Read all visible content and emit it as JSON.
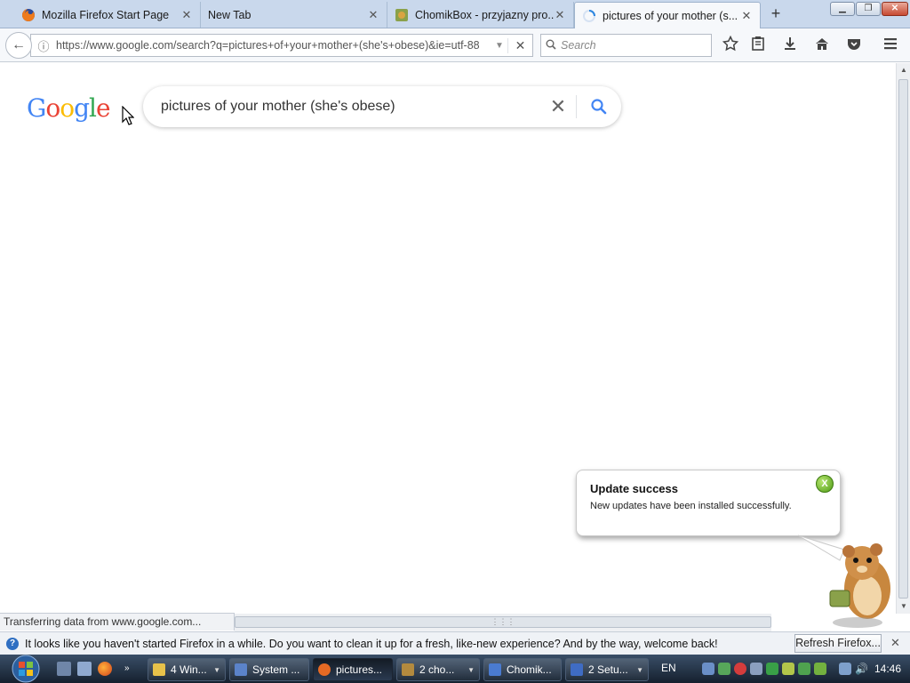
{
  "browser": {
    "tabs": [
      {
        "title": "Mozilla Firefox Start Page",
        "active": false
      },
      {
        "title": "New Tab",
        "active": false
      },
      {
        "title": "ChomikBox - przyjazny pro...",
        "active": false
      },
      {
        "title": "pictures of your mother (s...",
        "active": true
      }
    ],
    "url": "https://www.google.com/search?q=pictures+of+your+mother+(she's+obese)&ie=utf-88",
    "search_placeholder": "Search",
    "status_text": "Transferring data from www.google.com..."
  },
  "google": {
    "logo_letters": [
      {
        "ch": "G",
        "color": "#4285f4"
      },
      {
        "ch": "o",
        "color": "#ea4335"
      },
      {
        "ch": "o",
        "color": "#fbbc05"
      },
      {
        "ch": "g",
        "color": "#4285f4"
      },
      {
        "ch": "l",
        "color": "#34a853"
      },
      {
        "ch": "e",
        "color": "#ea4335"
      }
    ],
    "query": "pictures of your mother (she's obese)"
  },
  "notification": {
    "title": "Update success",
    "message": "New updates have been installed successfully.",
    "close_label": "X"
  },
  "infobar": {
    "message": "It looks like you haven't started Firefox in a while. Do you want to clean it up for a fresh, like-new experience? And by the way, welcome back!",
    "button_label": "Refresh Firefox..."
  },
  "taskbar": {
    "buttons": [
      {
        "label": "4 Win...",
        "icon_color": "#e8c24a"
      },
      {
        "label": "System ...",
        "icon_color": "#5b83c9"
      },
      {
        "label": "pictures...",
        "icon_color": "#e66a24"
      },
      {
        "label": "2 cho...",
        "icon_color": "#b38a3e"
      },
      {
        "label": "Chomik...",
        "icon_color": "#4a7bd0"
      },
      {
        "label": "2 Setu...",
        "icon_color": "#3f6cc4"
      }
    ],
    "language": "EN",
    "time": "14:46"
  }
}
